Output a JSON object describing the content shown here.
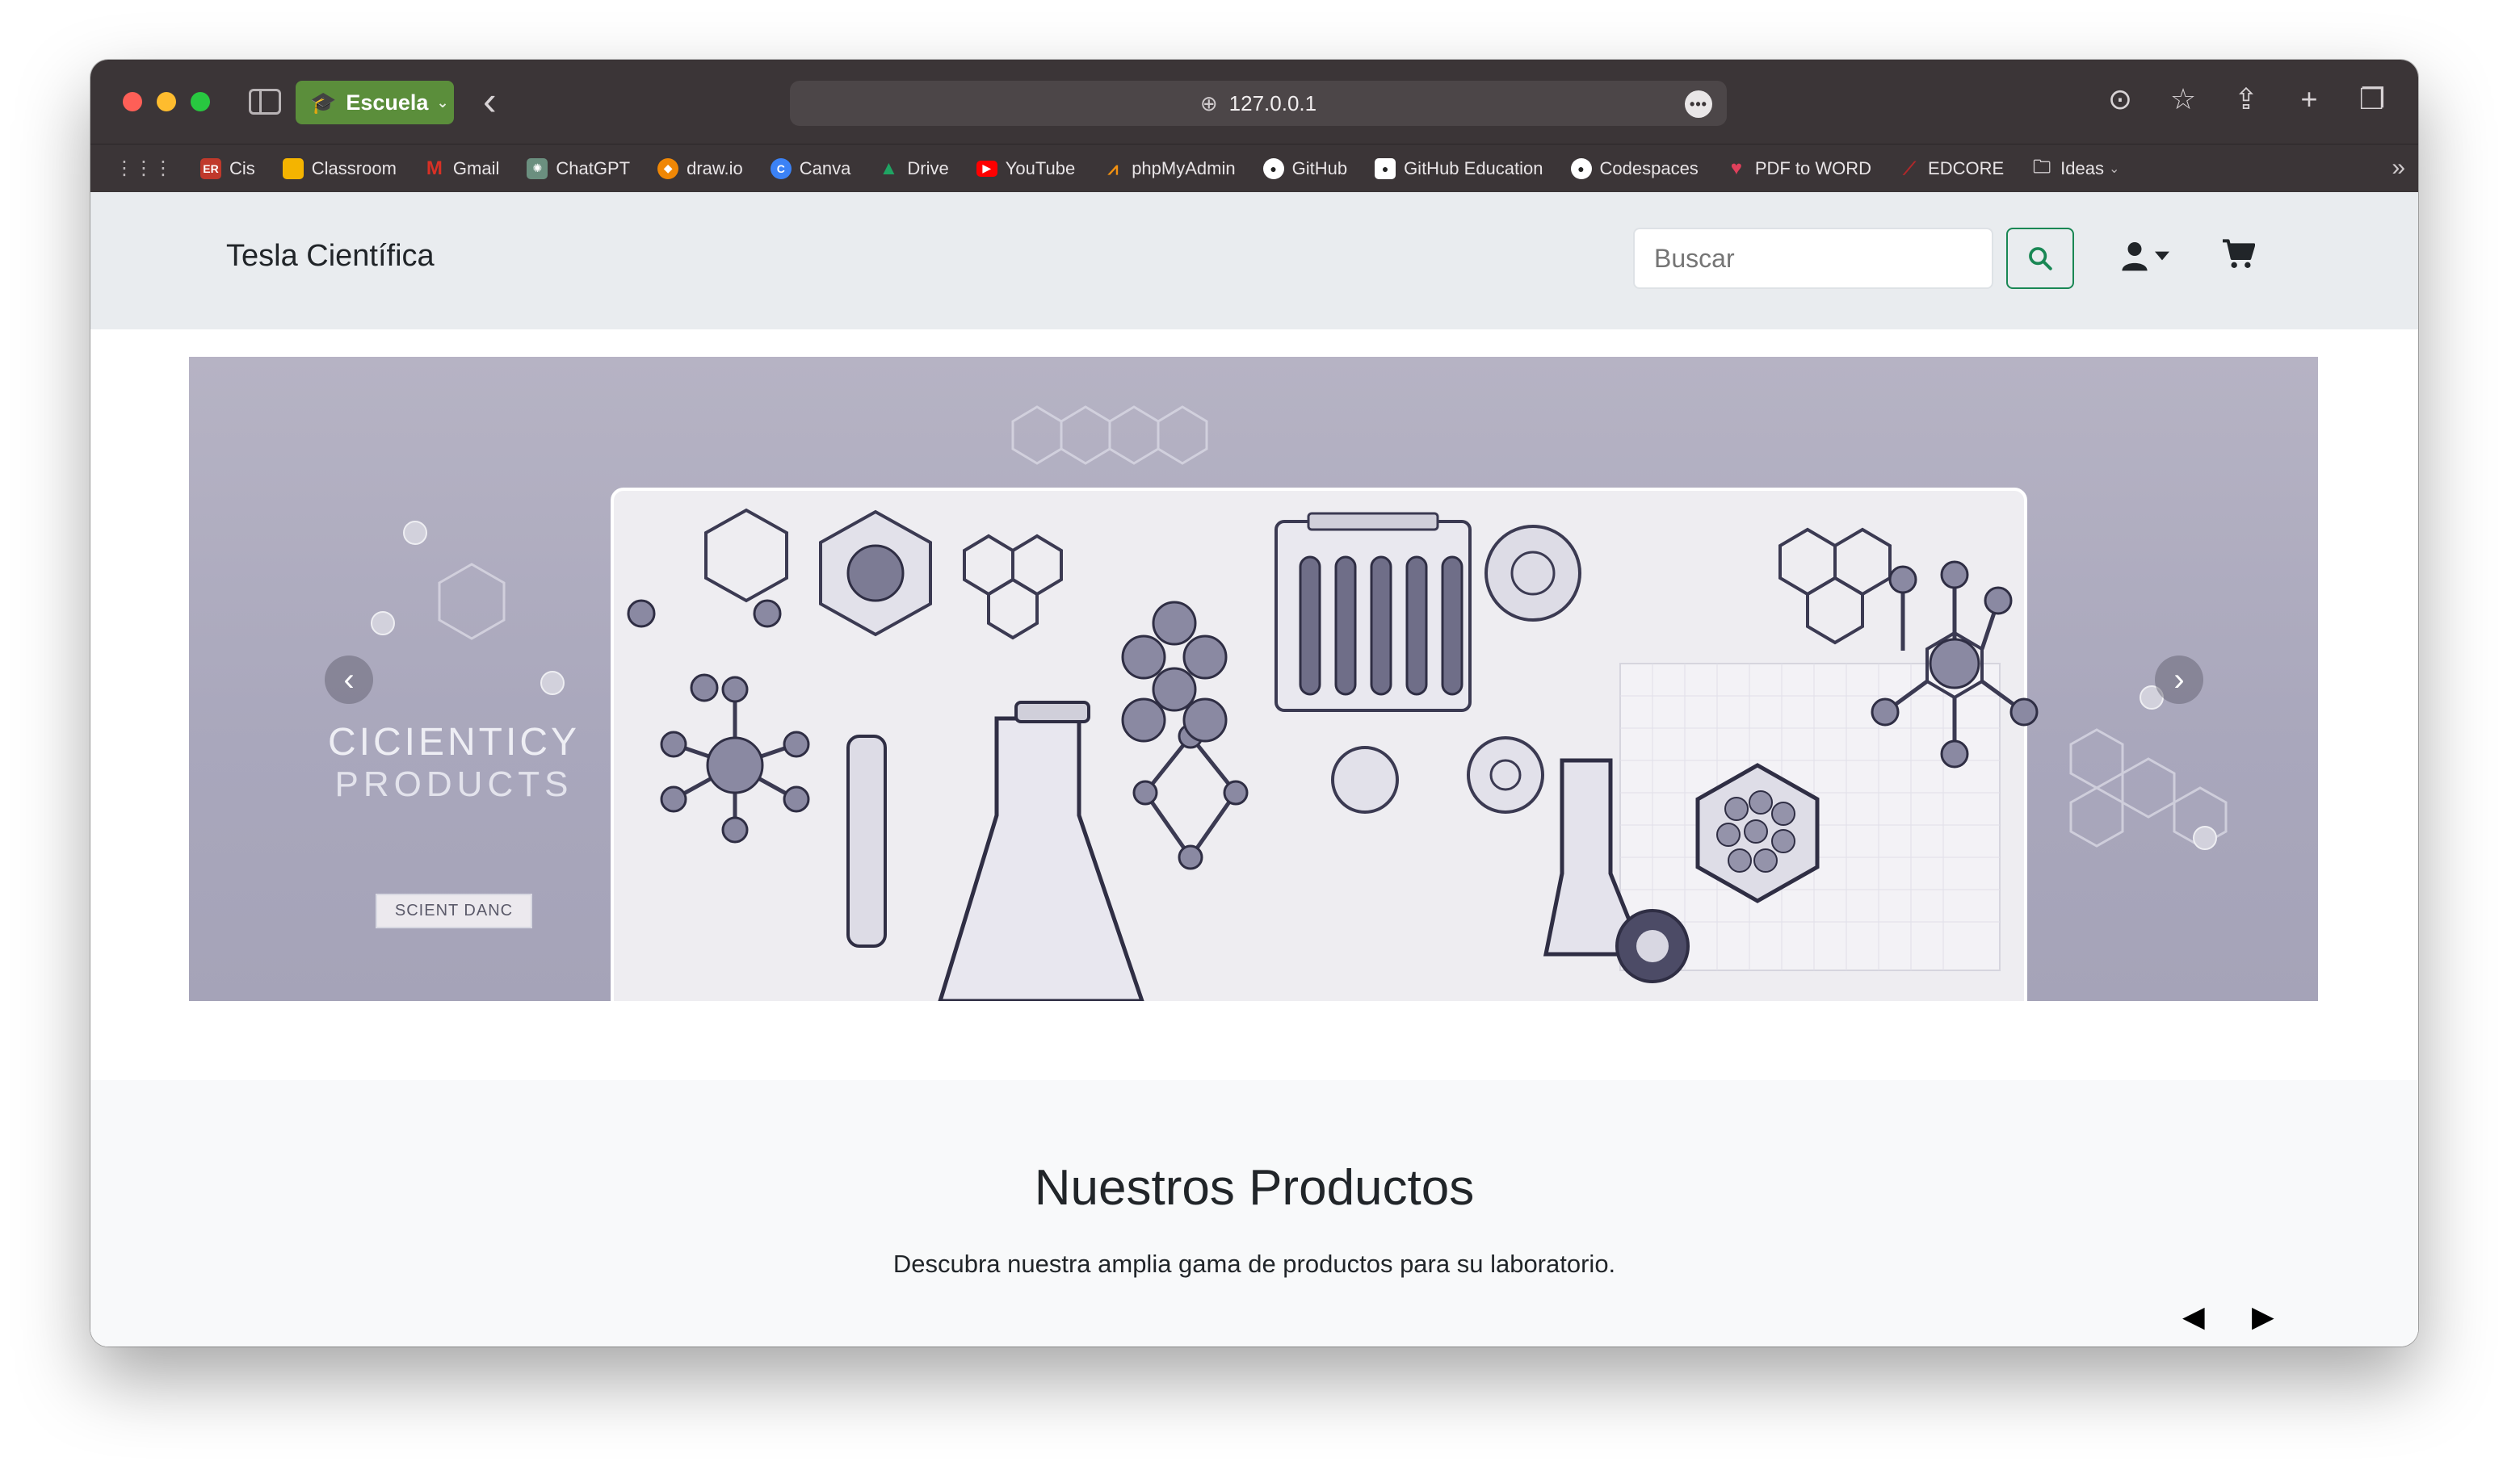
{
  "browser": {
    "profile_label": "Escuela",
    "url": "127.0.0.1",
    "bookmarks": [
      {
        "label": "Cis",
        "icon": "er-icon",
        "color": "#c0392b"
      },
      {
        "label": "Classroom",
        "icon": "classroom-icon",
        "color": "#f4b400"
      },
      {
        "label": "Gmail",
        "icon": "gmail-icon",
        "color": "#d93025"
      },
      {
        "label": "ChatGPT",
        "icon": "chatgpt-icon",
        "color": "#6b8f7f"
      },
      {
        "label": "draw.io",
        "icon": "drawio-icon",
        "color": "#f08705"
      },
      {
        "label": "Canva",
        "icon": "canva-icon",
        "color": "#3b82f6"
      },
      {
        "label": "Drive",
        "icon": "drive-icon",
        "color": "#1fa463"
      },
      {
        "label": "YouTube",
        "icon": "youtube-icon",
        "color": "#ff0000"
      },
      {
        "label": "phpMyAdmin",
        "icon": "phpmyadmin-icon",
        "color": "#f29111"
      },
      {
        "label": "GitHub",
        "icon": "github-icon",
        "color": "#ffffff"
      },
      {
        "label": "GitHub Education",
        "icon": "github-icon",
        "color": "#ffffff"
      },
      {
        "label": "Codespaces",
        "icon": "github-icon",
        "color": "#ffffff"
      },
      {
        "label": "PDF to WORD",
        "icon": "heart-icon",
        "color": "#e0405b"
      },
      {
        "label": "EDCORE",
        "icon": "edcore-icon",
        "color": "#b0282a"
      },
      {
        "label": "Ideas",
        "icon": "folder-icon",
        "color": "#cfcacc"
      }
    ]
  },
  "navbar": {
    "brand": "Tesla Científica",
    "search_placeholder": "Buscar",
    "accent": "#198754"
  },
  "carousel": {
    "hero_title": "CICIENTICY",
    "hero_subtitle": "PRODUCTS",
    "hero_button": "SCIENT DANC"
  },
  "products": {
    "title": "Nuestros Productos",
    "subtitle": "Descubra nuestra amplia gama de productos para su laboratorio."
  }
}
